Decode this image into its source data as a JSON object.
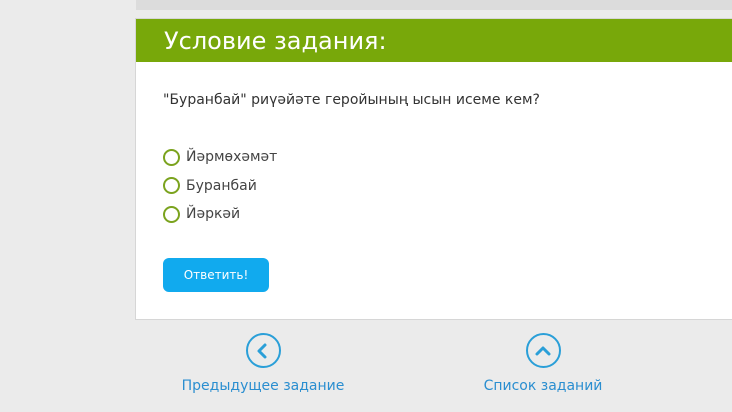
{
  "task": {
    "header_title": "Условие задания:",
    "question": "\"Буранбай\" риүәйәте геройының ысын исеме кем?",
    "options": [
      {
        "label": "Йәрмөхәмәт"
      },
      {
        "label": "Буранбай"
      },
      {
        "label": "Йәркәй"
      }
    ],
    "answer_button": "Ответить!"
  },
  "nav": {
    "prev_label": "Предыдущее задание",
    "list_label": "Список заданий"
  },
  "colors": {
    "header_green": "#78a80a",
    "radio_green": "#7ba31e",
    "button_blue": "#11aaee",
    "link_blue": "#2a8ed0"
  },
  "icons": {
    "prev": "chevron-left-circle-icon",
    "list": "chevron-up-circle-icon"
  }
}
